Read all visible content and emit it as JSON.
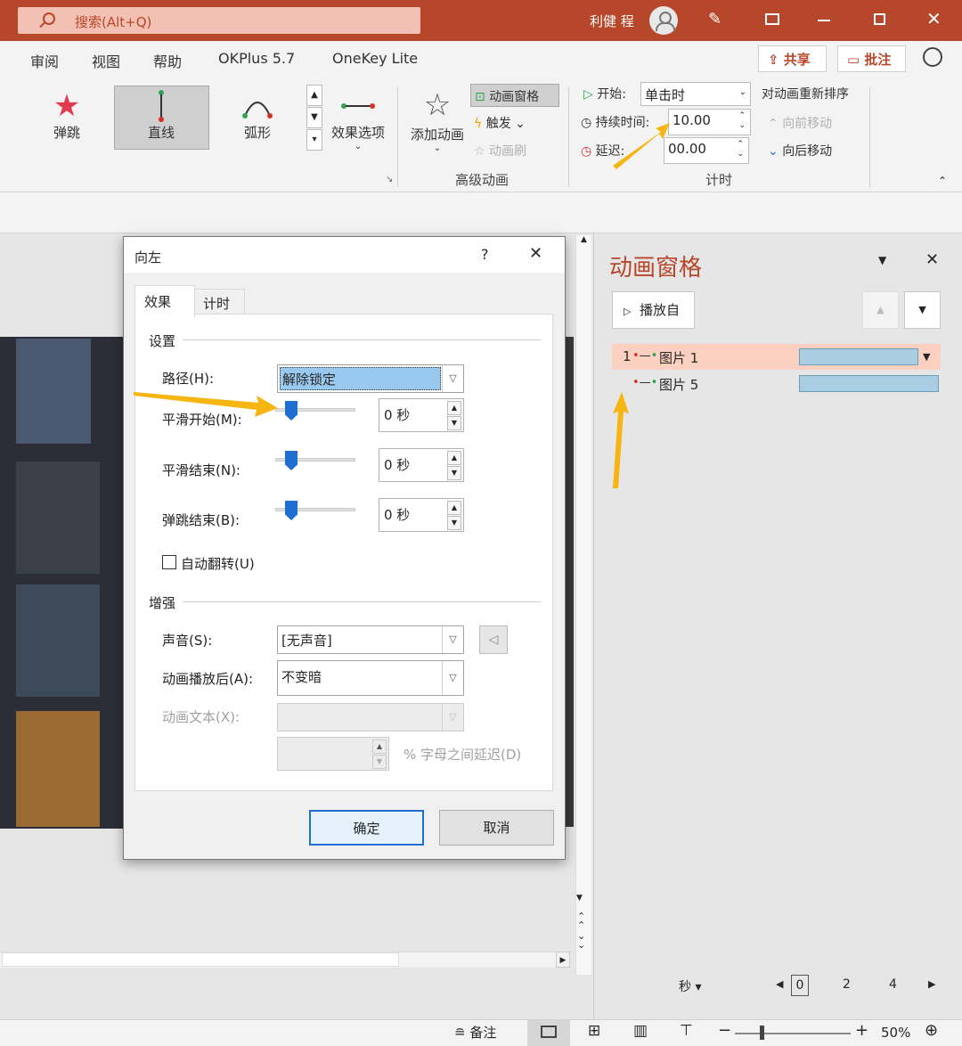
{
  "titlebar": {
    "search_text": "搜索(Alt+Q)",
    "user_name": "利健 程"
  },
  "menu": {
    "items": [
      "审阅",
      "视图",
      "帮助",
      "OKPlus 5.7",
      "OneKey Lite"
    ],
    "share": "共享",
    "comment": "批注"
  },
  "ribbon": {
    "effects": [
      "弹跳",
      "直线",
      "弧形"
    ],
    "effect_options": "效果选项",
    "add_animation": "添加动画",
    "animation_pane": "动画窗格",
    "trigger": "触发",
    "anim_painter": "动画刷",
    "advanced_group": "高级动画",
    "start_label": "开始:",
    "start_value": "单击时",
    "duration_label": "持续时间:",
    "duration_value": "10.00",
    "delay_label": "延迟:",
    "delay_value": "00.00",
    "timing_group": "计时",
    "reorder_title": "对动画重新排序",
    "move_earlier": "向前移动",
    "move_later": "向后移动"
  },
  "dialog": {
    "title": "向左",
    "help": "?",
    "tabs": [
      "效果",
      "计时"
    ],
    "settings_section": "设置",
    "path_label": "路径(H):",
    "path_value": "解除锁定",
    "smooth_start_label": "平滑开始(M):",
    "smooth_end_label": "平滑结束(N):",
    "bounce_end_label": "弹跳结束(B):",
    "smooth_start_value": "0 秒",
    "smooth_end_value": "0 秒",
    "bounce_end_value": "0 秒",
    "auto_reverse_label": "自动翻转(U)",
    "enhance_section": "增强",
    "sound_label": "声音(S):",
    "sound_value": "[无声音]",
    "after_anim_label": "动画播放后(A):",
    "after_anim_value": "不变暗",
    "anim_text_label": "动画文本(X):",
    "letter_delay_label": "% 字母之间延迟(D)",
    "ok": "确定",
    "cancel": "取消"
  },
  "pane": {
    "title": "动画窗格",
    "play_from": "播放自",
    "items": [
      {
        "index": "1",
        "name": "图片 1"
      },
      {
        "index": "",
        "name": "图片 5"
      }
    ],
    "unit": "秒",
    "ticks": [
      "0",
      "2",
      "4"
    ]
  },
  "status": {
    "notes": "备注",
    "zoom": "50%"
  },
  "colors": {
    "accent": "#b7472a",
    "highlight": "#fbd0c0",
    "bar": "#a9cde3",
    "arrow": "#f7b512"
  }
}
